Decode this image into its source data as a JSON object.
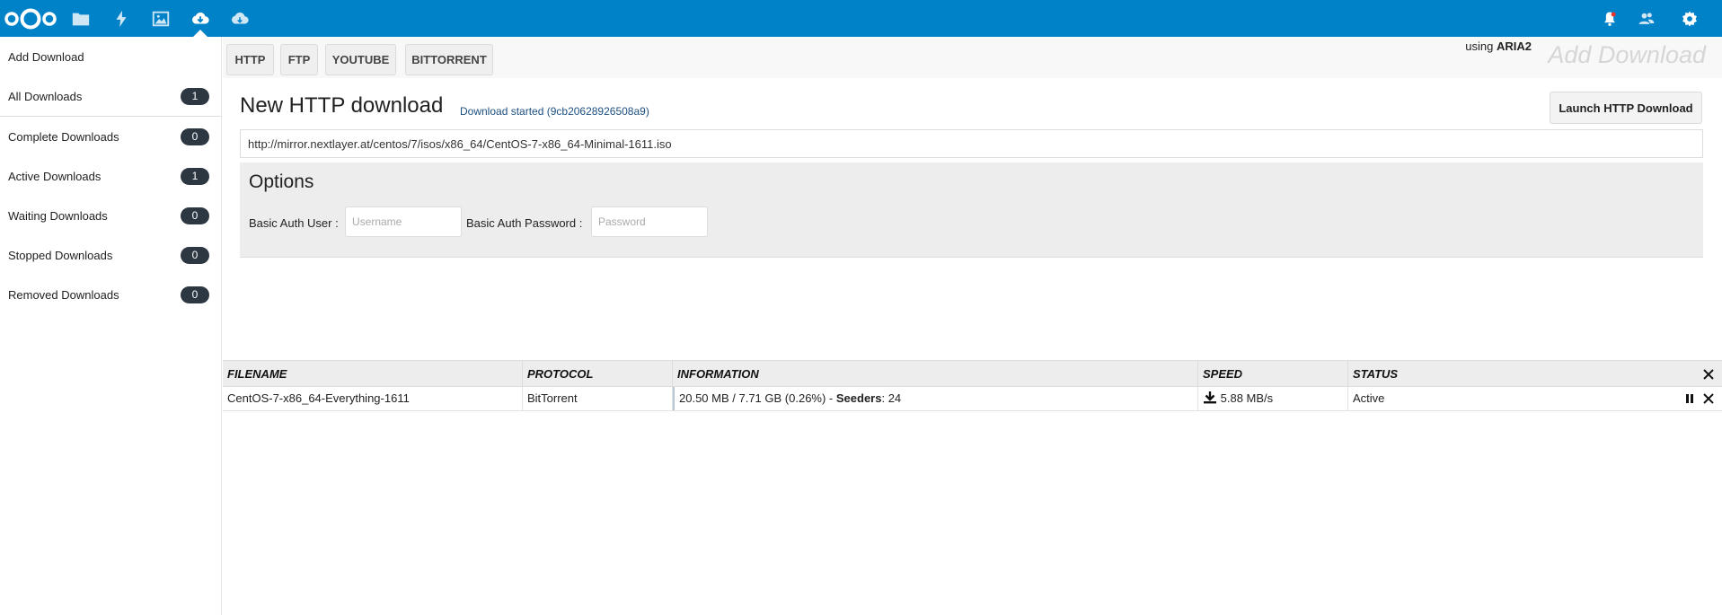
{
  "colors": {
    "header_bg": "#0082c9",
    "badge_bg": "#2c3742",
    "status_link": "#1d4f80"
  },
  "header": {
    "apps": [
      {
        "name": "files",
        "icon": "folder-icon"
      },
      {
        "name": "activity",
        "icon": "lightning-icon"
      },
      {
        "name": "gallery",
        "icon": "image-icon"
      },
      {
        "name": "ocdownloader",
        "icon": "cloud-download-icon",
        "active": true
      },
      {
        "name": "cloud",
        "icon": "cloud-icon"
      }
    ],
    "right_icons": [
      "notifications-icon",
      "contacts-icon",
      "settings-icon"
    ]
  },
  "sidebar": {
    "items": [
      {
        "label": "Add Download"
      },
      {
        "label": "All Downloads",
        "count": "1"
      },
      {
        "label": "Complete Downloads",
        "count": "0"
      },
      {
        "label": "Active Downloads",
        "count": "1"
      },
      {
        "label": "Waiting Downloads",
        "count": "0"
      },
      {
        "label": "Stopped Downloads",
        "count": "0"
      },
      {
        "label": "Removed Downloads",
        "count": "0"
      }
    ]
  },
  "toolbar": {
    "tabs": [
      "HTTP",
      "FTP",
      "YOUTUBE",
      "BITTORRENT"
    ],
    "using_prefix": "using",
    "using_engine": "ARIA2",
    "ghost_title": "Add Download"
  },
  "form": {
    "title": "New HTTP download",
    "status": "Download started (9cb20628926508a9)",
    "launch_label": "Launch HTTP Download",
    "url_value": "http://mirror.nextlayer.at/centos/7/isos/x86_64/CentOS-7-x86_64-Minimal-1611.iso",
    "options_title": "Options",
    "auth_user_label": "Basic Auth User :",
    "auth_user_placeholder": "Username",
    "auth_pass_label": "Basic Auth Password :",
    "auth_pass_placeholder": "Password"
  },
  "table": {
    "columns": [
      "FILENAME",
      "PROTOCOL",
      "INFORMATION",
      "SPEED",
      "STATUS"
    ],
    "rows": [
      {
        "filename": "CentOS-7-x86_64-Everything-1611",
        "protocol": "BitTorrent",
        "info_prefix": "20.50 MB / 7.71 GB (0.26%) -",
        "seeders_label": "Seeders",
        "seeders_value": ": 24",
        "speed": "5.88 MB/s",
        "status": "Active"
      }
    ]
  }
}
